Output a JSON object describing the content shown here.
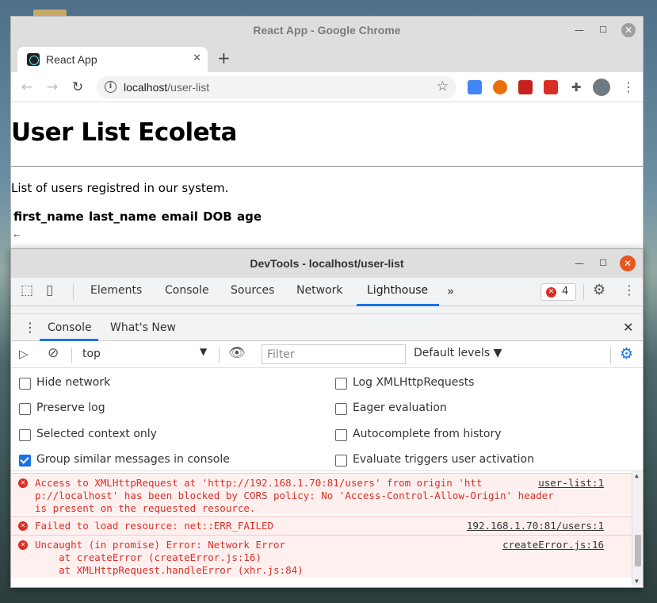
{
  "browser": {
    "window_title": "React App - Google Chrome",
    "tab_title": "React App",
    "url_host": "localhost",
    "url_path": "/user-list"
  },
  "page": {
    "heading": "User List Ecoleta",
    "description": "List of users registred in our system.",
    "table_headers": [
      "first_name",
      "last_name",
      "email",
      "DOB",
      "age"
    ],
    "back_glyph": "←"
  },
  "devtools": {
    "window_title": "DevTools - localhost/user-list",
    "tabs": [
      "Elements",
      "Console",
      "Sources",
      "Network",
      "Lighthouse"
    ],
    "selected_tab": "Lighthouse",
    "error_count": "4",
    "drawer_tabs": [
      "Console",
      "What's New"
    ],
    "context": "top",
    "filter_placeholder": "Filter",
    "levels_label": "Default levels ▼",
    "settings_left": [
      {
        "label": "Hide network",
        "checked": false
      },
      {
        "label": "Preserve log",
        "checked": false
      },
      {
        "label": "Selected context only",
        "checked": false
      },
      {
        "label": "Group similar messages in console",
        "checked": true
      }
    ],
    "settings_right": [
      {
        "label": "Log XMLHttpRequests",
        "checked": false
      },
      {
        "label": "Eager evaluation",
        "checked": false
      },
      {
        "label": "Autocomplete from history",
        "checked": false
      },
      {
        "label": "Evaluate triggers user activation",
        "checked": false
      }
    ],
    "messages": [
      {
        "lines": [
          "Access to XMLHttpRequest at 'http://192.168.1.70:81/users' from origin 'htt",
          "p://localhost' has been blocked by CORS policy: No 'Access-Control-Allow-Origin' header",
          "is present on the requested resource."
        ],
        "source": "user-list:1"
      },
      {
        "lines": [
          "Failed to load resource: net::ERR_FAILED"
        ],
        "source": "192.168.1.70:81/users:1"
      },
      {
        "lines": [
          "Uncaught (in promise) Error: Network Error",
          "    at createError (createError.js:16)",
          "    at XMLHttpRequest.handleError (xhr.js:84)"
        ],
        "source": "createError.js:16"
      }
    ]
  },
  "colors": {
    "accent": "#1a73e8",
    "error": "#d93025",
    "error_bg": "#fff0f0",
    "ubuntu_close": "#e95420"
  }
}
